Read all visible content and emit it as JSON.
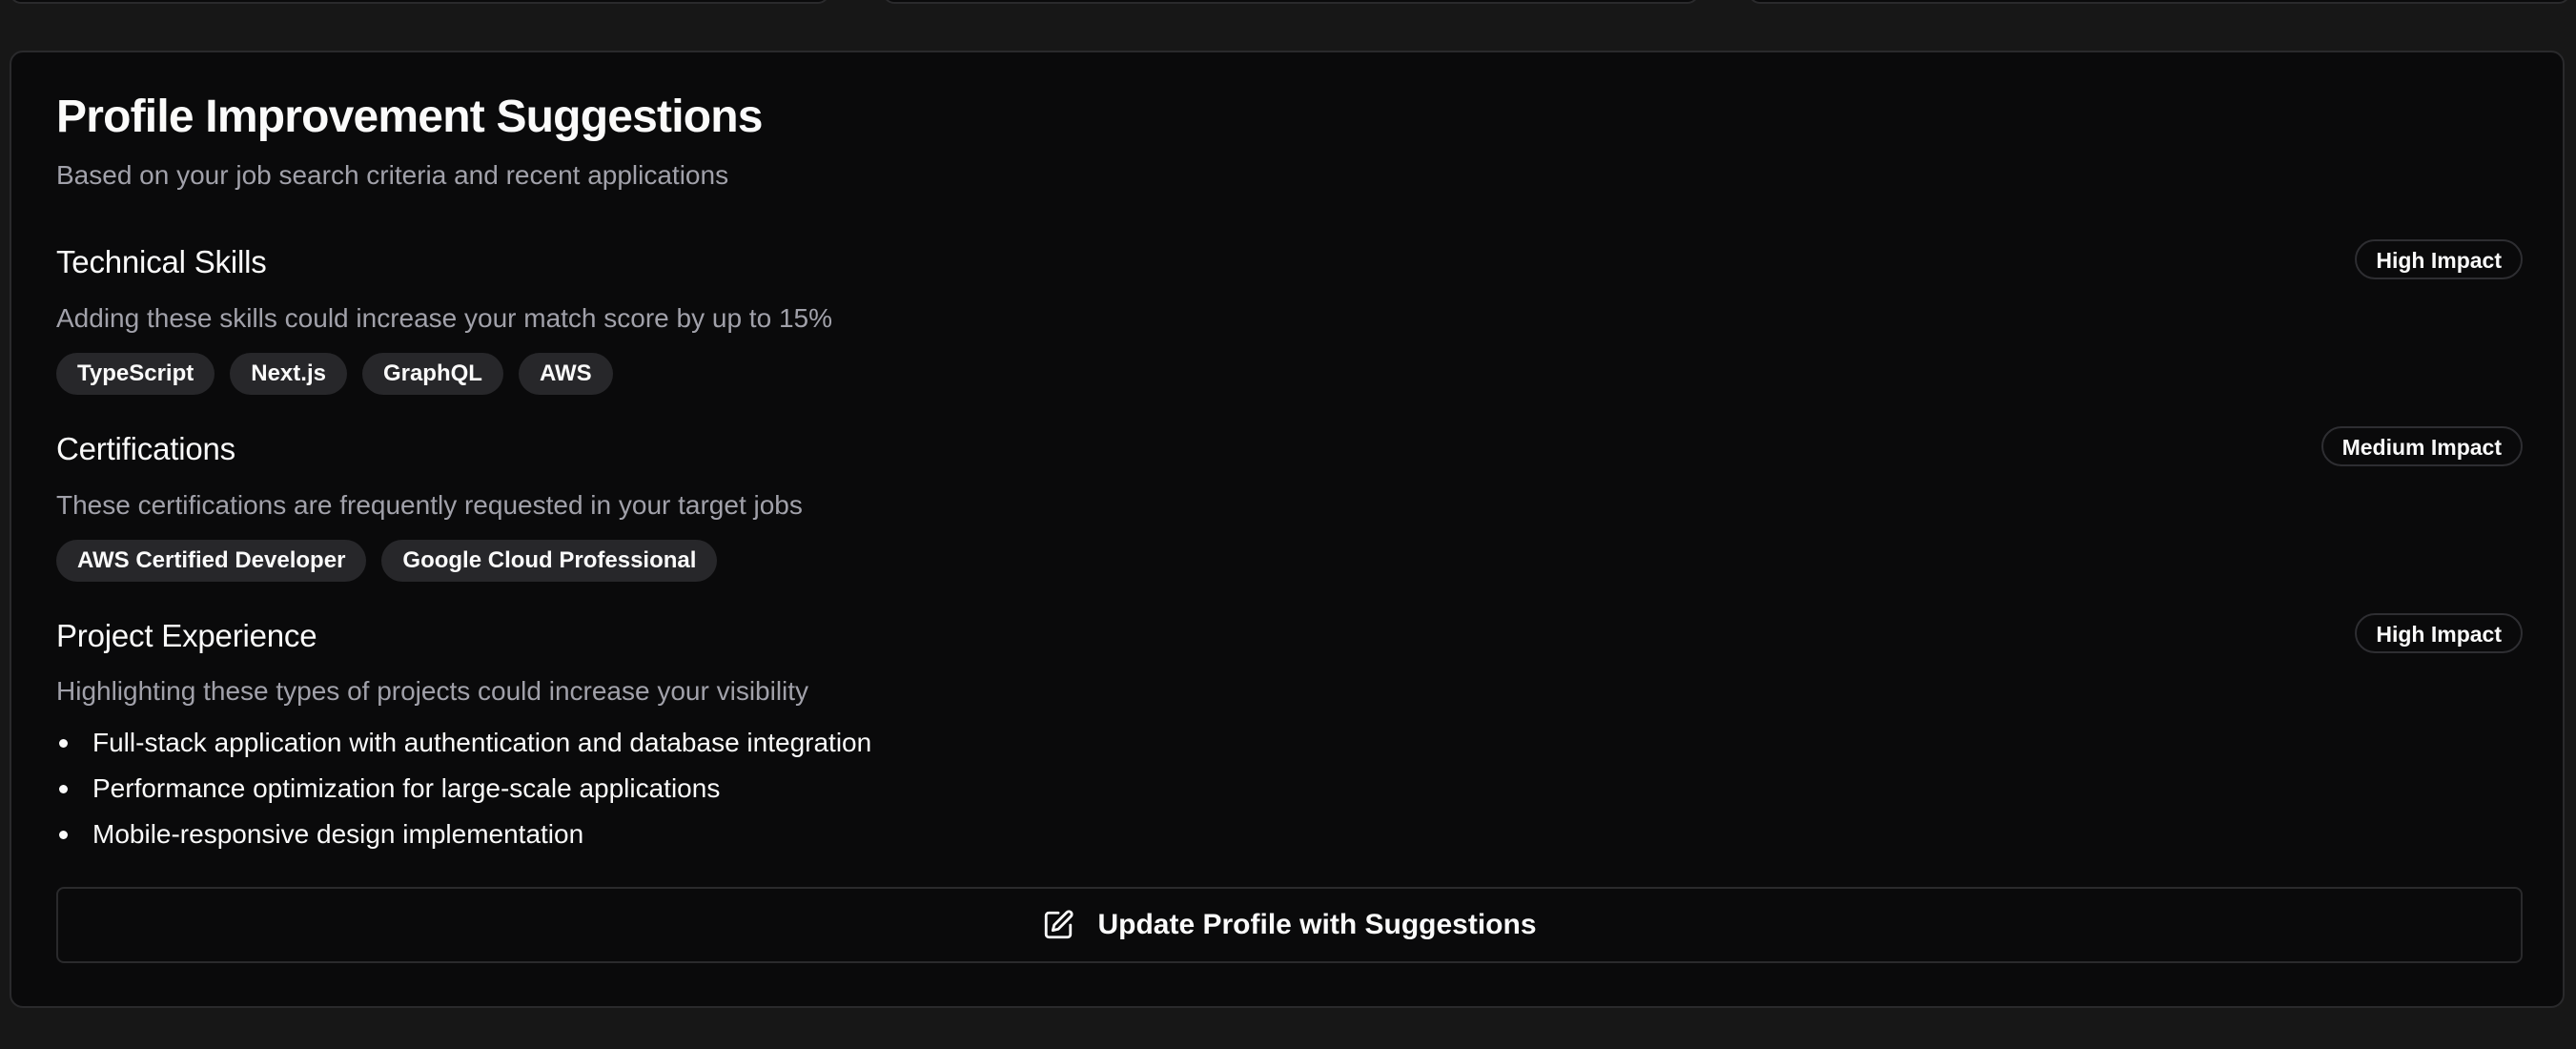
{
  "card": {
    "title": "Profile Improvement Suggestions",
    "subtitle": "Based on your job search criteria and recent applications"
  },
  "sections": [
    {
      "title": "Technical Skills",
      "impact": "High Impact",
      "description": "Adding these skills could increase your match score by up to 15%",
      "chips": [
        "TypeScript",
        "Next.js",
        "GraphQL",
        "AWS"
      ]
    },
    {
      "title": "Certifications",
      "impact": "Medium Impact",
      "description": "These certifications are frequently requested in your target jobs",
      "chips": [
        "AWS Certified Developer",
        "Google Cloud Professional"
      ]
    },
    {
      "title": "Project Experience",
      "impact": "High Impact",
      "description": "Highlighting these types of projects could increase your visibility",
      "bullets": [
        "Full-stack application with authentication and database integration",
        "Performance optimization for large-scale applications",
        "Mobile-responsive design implementation"
      ]
    }
  ],
  "update_button": {
    "icon": "edit-icon",
    "label": "Update Profile with Suggestions"
  },
  "colors": {
    "page_background": "#171717",
    "card_background": "#0a0a0b",
    "card_border": "#2a2a2c",
    "primary_text": "#fafafa",
    "muted_text": "#a1a1aa",
    "chip_background": "#27272a"
  }
}
